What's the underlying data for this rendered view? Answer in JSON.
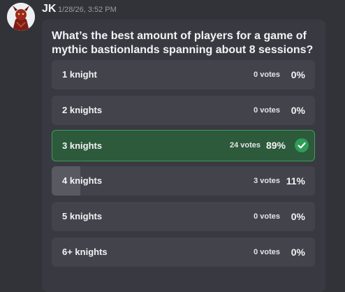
{
  "message": {
    "author": "JK",
    "timestamp": "1/28/26, 3:52 PM"
  },
  "poll": {
    "question": "What’s the best amount of players for a game of mythic bastionlands spanning about 8 sessions?",
    "accent_color": "#2e9c56",
    "options": [
      {
        "label": "1 knight",
        "votes": "0 votes",
        "percent": "0%",
        "fraction": 0
      },
      {
        "label": "2 knights",
        "votes": "0 votes",
        "percent": "0%",
        "fraction": 0
      },
      {
        "label": "3 knights",
        "votes": "24 votes",
        "percent": "89%",
        "fraction": 0.89,
        "selected": true,
        "icon": "checkmark-icon"
      },
      {
        "label": "4 knights",
        "votes": "3 votes",
        "percent": "11%",
        "fraction": 0.11
      },
      {
        "label": "5 knights",
        "votes": "0 votes",
        "percent": "0%",
        "fraction": 0
      },
      {
        "label": "6+ knights",
        "votes": "0 votes",
        "percent": "0%",
        "fraction": 0
      }
    ]
  }
}
